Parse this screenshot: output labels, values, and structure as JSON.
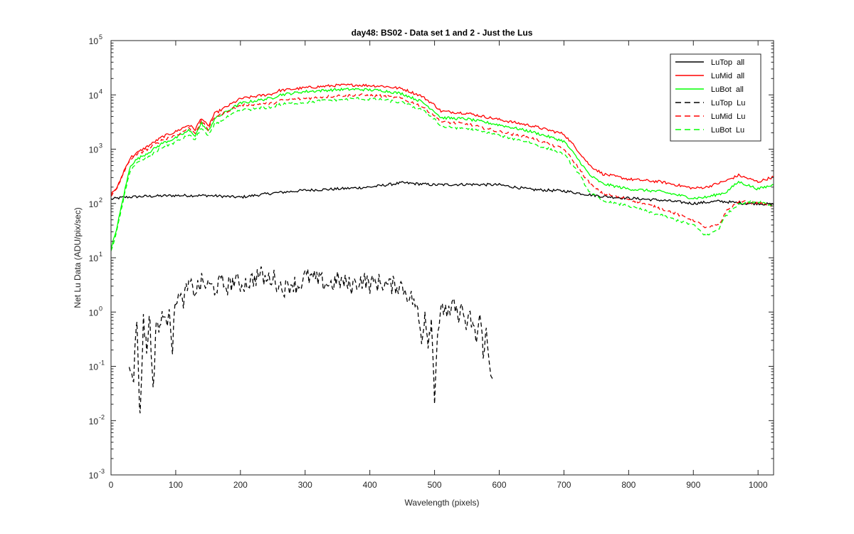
{
  "chart_data": {
    "type": "line",
    "title": "day48: BS02 - Data set 1 and 2 - Just the Lus",
    "xlabel": "Wavelength (pixels)",
    "ylabel": "Net Lu Data (ADU/pix/sec)",
    "xlim": [
      0,
      1024
    ],
    "ylim": [
      0.001,
      100000
    ],
    "yscale": "log",
    "grid": false,
    "legend_position": "top-right",
    "x_ticks": [
      "0",
      "100",
      "200",
      "300",
      "400",
      "500",
      "600",
      "700",
      "800",
      "900",
      "1000"
    ],
    "y_ticks": [
      {
        "base": "10",
        "exp": "-3"
      },
      {
        "base": "10",
        "exp": "-2"
      },
      {
        "base": "10",
        "exp": "-1"
      },
      {
        "base": "10",
        "exp": "0"
      },
      {
        "base": "10",
        "exp": "1"
      },
      {
        "base": "10",
        "exp": "2"
      },
      {
        "base": "10",
        "exp": "3"
      },
      {
        "base": "10",
        "exp": "4"
      },
      {
        "base": "10",
        "exp": "5"
      }
    ],
    "series": [
      {
        "name": "LuTop  all",
        "color": "#000000",
        "style": "solid",
        "x": [
          0,
          20,
          50,
          100,
          150,
          200,
          250,
          300,
          350,
          400,
          450,
          500,
          550,
          600,
          650,
          700,
          730,
          760,
          800,
          850,
          900,
          940,
          980,
          1000,
          1024
        ],
        "y": [
          120,
          130,
          135,
          140,
          140,
          130,
          155,
          175,
          185,
          200,
          240,
          220,
          225,
          220,
          180,
          170,
          150,
          135,
          125,
          115,
          100,
          110,
          100,
          100,
          95
        ]
      },
      {
        "name": "LuMid  all",
        "color": "#ff0000",
        "style": "solid",
        "x": [
          0,
          10,
          20,
          30,
          40,
          60,
          80,
          100,
          120,
          130,
          140,
          150,
          160,
          200,
          250,
          260,
          300,
          350,
          380,
          420,
          450,
          480,
          500,
          510,
          550,
          600,
          650,
          700,
          720,
          740,
          760,
          800,
          850,
          900,
          920,
          950,
          970,
          1000,
          1024
        ],
        "y": [
          150,
          200,
          400,
          700,
          850,
          1200,
          1700,
          2100,
          2800,
          2300,
          3800,
          2600,
          4500,
          8500,
          10500,
          12000,
          13500,
          15000,
          15200,
          14500,
          13000,
          9500,
          6500,
          5000,
          4600,
          3500,
          2700,
          1900,
          1000,
          500,
          350,
          280,
          250,
          190,
          200,
          260,
          330,
          250,
          310
        ]
      },
      {
        "name": "LuBot  all",
        "color": "#00ff00",
        "style": "solid",
        "x": [
          0,
          10,
          20,
          30,
          40,
          60,
          80,
          100,
          120,
          130,
          140,
          150,
          160,
          200,
          250,
          260,
          300,
          350,
          380,
          420,
          450,
          480,
          500,
          510,
          550,
          600,
          650,
          700,
          720,
          740,
          760,
          800,
          850,
          900,
          920,
          950,
          970,
          1000,
          1024
        ],
        "y": [
          14,
          40,
          150,
          500,
          650,
          900,
          1300,
          1600,
          2200,
          1800,
          3000,
          2100,
          3600,
          7000,
          8800,
          10000,
          11500,
          12500,
          12700,
          12000,
          10500,
          7500,
          5000,
          3800,
          3600,
          2800,
          2100,
          1400,
          700,
          330,
          230,
          185,
          165,
          125,
          130,
          160,
          250,
          185,
          220
        ]
      },
      {
        "name": "LuTop  Lu",
        "color": "#000000",
        "style": "dashed",
        "x": [
          28,
          35,
          40,
          45,
          50,
          55,
          60,
          65,
          70,
          75,
          80,
          85,
          90,
          95,
          100,
          110,
          120,
          130,
          140,
          150,
          160,
          170,
          180,
          190,
          200,
          210,
          220,
          230,
          240,
          250,
          260,
          270,
          280,
          290,
          300,
          310,
          320,
          330,
          340,
          350,
          360,
          370,
          380,
          390,
          400,
          410,
          420,
          430,
          440,
          450,
          460,
          470,
          475,
          480,
          485,
          490,
          495,
          500,
          505,
          510,
          515,
          520,
          525,
          530,
          535,
          540,
          545,
          550,
          555,
          560,
          565,
          570,
          575,
          580,
          585,
          590
        ],
        "y": [
          0.13,
          0.07,
          0.7,
          0.01,
          0.8,
          0.2,
          0.9,
          0.03,
          0.8,
          0.4,
          1.2,
          0.5,
          1.5,
          0.2,
          2.0,
          1.5,
          3.0,
          2.5,
          3.5,
          3.0,
          2.8,
          3.5,
          3.0,
          3.8,
          3.2,
          3.5,
          4.0,
          5.0,
          3.8,
          4.5,
          3.0,
          2.8,
          3.5,
          3.0,
          4.5,
          4.2,
          3.8,
          3.5,
          3.2,
          3.8,
          3.5,
          3.0,
          3.5,
          4.0,
          3.2,
          3.5,
          3.5,
          3.0,
          3.2,
          3.0,
          2.0,
          1.5,
          0.8,
          0.3,
          1.0,
          0.3,
          0.7,
          0.03,
          0.5,
          0.9,
          1.2,
          1.0,
          0.8,
          1.6,
          0.8,
          1.2,
          0.9,
          0.5,
          0.8,
          0.5,
          0.3,
          0.9,
          0.2,
          0.4,
          0.1,
          0.07
        ]
      },
      {
        "name": "LuMid  Lu",
        "color": "#ff0000",
        "style": "dashed",
        "x": [
          0,
          10,
          20,
          30,
          40,
          60,
          80,
          100,
          120,
          130,
          140,
          150,
          160,
          200,
          250,
          260,
          300,
          350,
          380,
          420,
          450,
          480,
          500,
          510,
          550,
          600,
          650,
          700,
          720,
          740,
          760,
          800,
          850,
          900,
          920,
          940,
          950,
          970,
          1000,
          1024
        ],
        "y": [
          140,
          190,
          380,
          650,
          800,
          1050,
          1500,
          1800,
          2400,
          2000,
          3300,
          2300,
          3900,
          6500,
          7000,
          7800,
          8600,
          9600,
          10000,
          9500,
          8500,
          6200,
          4200,
          3200,
          2900,
          2100,
          1600,
          1000,
          500,
          230,
          150,
          120,
          80,
          50,
          35,
          40,
          70,
          110,
          100,
          90
        ]
      },
      {
        "name": "LuBot  Lu",
        "color": "#00ff00",
        "style": "dashed",
        "x": [
          0,
          10,
          20,
          30,
          40,
          60,
          80,
          100,
          120,
          130,
          140,
          150,
          160,
          200,
          250,
          260,
          300,
          350,
          380,
          420,
          450,
          480,
          500,
          510,
          550,
          600,
          650,
          700,
          720,
          740,
          760,
          800,
          850,
          900,
          920,
          940,
          950,
          970,
          1000,
          1024
        ],
        "y": [
          13,
          35,
          130,
          420,
          550,
          750,
          1100,
          1350,
          1800,
          1500,
          2500,
          1700,
          2900,
          5200,
          6000,
          6600,
          7300,
          8200,
          8500,
          8100,
          7200,
          5300,
          3600,
          2600,
          2400,
          1800,
          1300,
          800,
          400,
          160,
          110,
          90,
          60,
          40,
          25,
          35,
          60,
          100,
          110,
          90
        ]
      }
    ]
  }
}
